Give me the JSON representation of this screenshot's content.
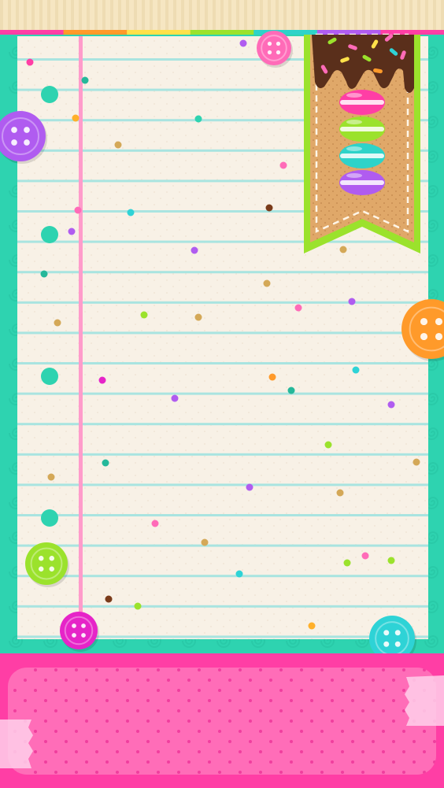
{
  "wallpaper": {
    "background": "#2ed3b0",
    "top_strip": "#f6e6c2",
    "rainbow": [
      "#ff3ea5",
      "#ff9a2a",
      "#ffe14a",
      "#9be22c",
      "#2ed3c9",
      "#b05cf0",
      "#ff3ea5"
    ],
    "paper_color": "#f8f1e6",
    "paper_line_color": "#a9e4e0",
    "margin_line_color": "#ff9ccb",
    "dock_color": "#ff3ea5",
    "dock_inner_color": "#ff6db8",
    "buttons": [
      {
        "name": "button-purple",
        "color": "#b05cf0"
      },
      {
        "name": "button-pink-small",
        "color": "#ff6bb8"
      },
      {
        "name": "button-orange",
        "color": "#ff9a2a"
      },
      {
        "name": "button-lime",
        "color": "#9be22c"
      },
      {
        "name": "button-magenta",
        "color": "#e624c8"
      },
      {
        "name": "button-cyan",
        "color": "#2ed3d6"
      }
    ],
    "macarons": [
      "#ff3ea5",
      "#9be22c",
      "#2ed3c9",
      "#b05cf0"
    ]
  }
}
